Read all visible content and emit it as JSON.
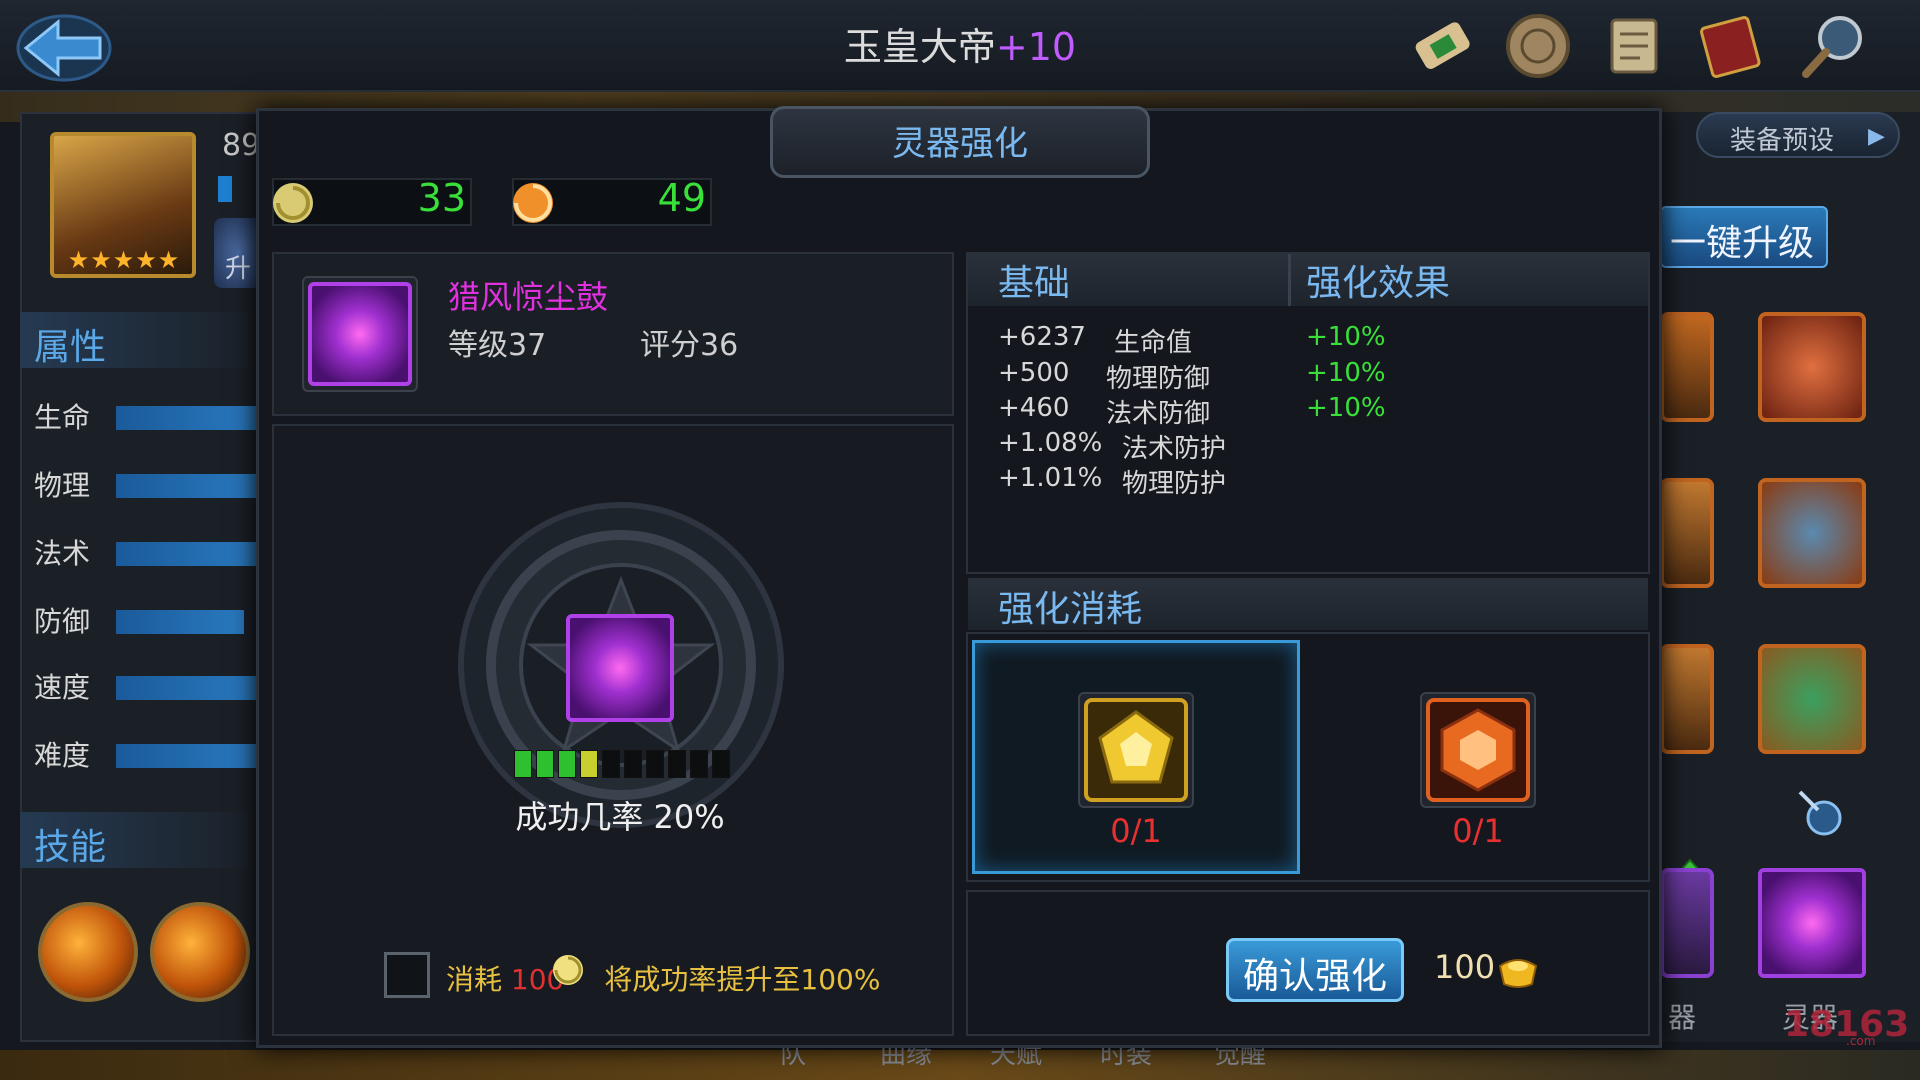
{
  "header": {
    "title": "玉皇大帝",
    "title_plus": "+10",
    "icons": [
      "scroll-icon",
      "medallion-icon",
      "paper-scroll-icon",
      "book-icon",
      "magnifier-icon"
    ]
  },
  "hero": {
    "level": "89",
    "rank_badge": "升",
    "star_count": 5,
    "stars": "★★★★★"
  },
  "attributes": {
    "title": "属性",
    "items": [
      {
        "label": "生命",
        "level": 1.0
      },
      {
        "label": "物理",
        "level": 1.0
      },
      {
        "label": "法术",
        "level": 1.0
      },
      {
        "label": "防御",
        "level": 0.85
      },
      {
        "label": "速度",
        "level": 1.0
      },
      {
        "label": "难度",
        "level": 1.0
      }
    ]
  },
  "skills": {
    "title": "技能",
    "icons": [
      "fire-orb-icon",
      "lightning-figure-icon"
    ]
  },
  "equipment": {
    "preset_label": "装备预设",
    "onekey_label": "一键升级",
    "qi_label": "器",
    "spirit_label": "灵器",
    "watermark": "18163",
    "watermark_sub": ".com"
  },
  "bottom_tabs": [
    "队",
    "曲缘",
    "天赋",
    "时装",
    "觉醒"
  ],
  "dialog": {
    "title": "灵器强化",
    "currency": [
      {
        "icon": "spirit-swirl-icon",
        "value": "33"
      },
      {
        "icon": "flame-swirl-icon",
        "value": "49"
      }
    ],
    "item": {
      "name": "猎风惊尘鼓",
      "level": "等级37",
      "score": "评分36",
      "icon": "drum-icon"
    },
    "enhance": {
      "success_rate": "成功几率 20%",
      "progress_filled": 4,
      "progress_total": 10,
      "boost_text_pre": "消耗",
      "boost_amount": "100",
      "boost_text_post": "将成功率提升至100%"
    },
    "stats": {
      "header_base": "基础",
      "header_effect": "强化效果",
      "rows": [
        {
          "value": "+6237",
          "name": "生命值",
          "effect": "+10%"
        },
        {
          "value": "+500",
          "name": "物理防御",
          "effect": "+10%"
        },
        {
          "value": "+460",
          "name": "法术防御",
          "effect": "+10%"
        },
        {
          "value": "+1.08%",
          "name": "法术防护",
          "effect": ""
        },
        {
          "value": "+1.01%",
          "name": "物理防护",
          "effect": ""
        }
      ]
    },
    "cost": {
      "title": "强化消耗",
      "materials": [
        {
          "icon": "gold-crystal-icon",
          "count": "0/1"
        },
        {
          "icon": "fire-crystal-icon",
          "count": "0/1"
        }
      ]
    },
    "confirm": {
      "label": "确认强化",
      "cost": "100",
      "cost_icon": "gold-ingot-icon"
    }
  }
}
